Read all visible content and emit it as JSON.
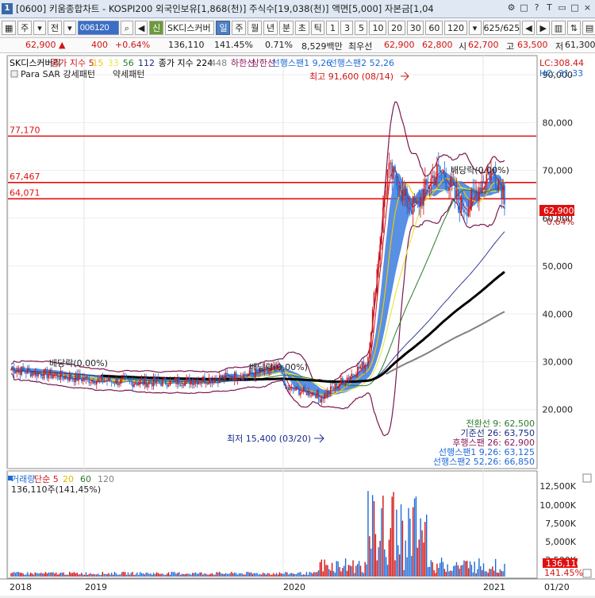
{
  "titlebar": {
    "icon_text": "1",
    "title": "[0600] 키움종합차트 - KOSPI200 외국인보유[1,868(천)] 주식수[19,038(천)] 액면[5,000] 자본금[1,04",
    "icons": [
      "gear-icon",
      "restore-icon",
      "help-icon",
      "pin-icon",
      "minimize-icon",
      "maximize-icon",
      "close-icon"
    ],
    "icon_glyphs": [
      "⚙",
      "□",
      "?",
      "T",
      "▭",
      "□",
      "×"
    ]
  },
  "toolbar": {
    "market": "주",
    "prev": "전",
    "code": "006120",
    "credit": "신",
    "stock_name": "SK디스커버",
    "periods": [
      "일",
      "주",
      "월",
      "년",
      "분",
      "초",
      "틱"
    ],
    "active_period": "일",
    "intervals": [
      "1",
      "3",
      "5",
      "10",
      "20",
      "30",
      "60",
      "120"
    ],
    "count": "625/625"
  },
  "quote": {
    "price": "62,900 ▲",
    "change": "400",
    "pct": "+0.64%",
    "volume": "136,110",
    "vol_ratio": "141.45%",
    "turnover": "0.71%",
    "amount": "8,529백만",
    "pref_label": "최우선",
    "ask": "62,900",
    "bid": "62,800",
    "open_label": "시",
    "open": "62,700",
    "high_label": "고",
    "high": "63,500",
    "low_label": "저",
    "low": "61,300"
  },
  "legend": {
    "line1": [
      {
        "text": "SK디스커버리",
        "color": "#000000"
      },
      {
        "text": "종가 지수 5",
        "color": "#d21414"
      },
      {
        "text": "15",
        "color": "#f0c800"
      },
      {
        "text": "33",
        "color": "#e6e64b"
      },
      {
        "text": "56",
        "color": "#2c7a2c"
      },
      {
        "text": "112",
        "color": "#1a2a8a"
      },
      {
        "text": "종가 지수 224",
        "color": "#000000"
      },
      {
        "text": "448",
        "color": "#808080"
      },
      {
        "text": "하한선",
        "color": "#8b1a5b"
      },
      {
        "text": "상한선",
        "color": "#8b1a5b"
      },
      {
        "text": "선행스팬1 9,26",
        "color": "#1e6bd6"
      },
      {
        "text": "선행스팬2 52,26",
        "color": "#1e6bd6"
      }
    ],
    "line2": [
      {
        "text": "Para SAR 강세패턴",
        "color": "#000000"
      },
      {
        "text": "약세패턴",
        "color": "#000000"
      }
    ],
    "lc": "LC:308.44",
    "hc": "HC:-31.33"
  },
  "price_axis": [
    "90,000",
    "80,000",
    "70,000",
    "60,000",
    "50,000",
    "40,000",
    "30,000",
    "20,000"
  ],
  "hlines": [
    {
      "label": "77,170",
      "value": 77170
    },
    {
      "label": "67,467",
      "value": 67467
    },
    {
      "label": "64,071",
      "value": 64071
    }
  ],
  "annotations": {
    "high": "최고 91,600 (08/14)",
    "low": "최저 15,400 (03/20)",
    "div1": "배당락(0.00%)",
    "div2": "배당락(0.00%)",
    "div3": "배당락(0.00%)"
  },
  "current": {
    "price": "62,900",
    "pct": "0.64%"
  },
  "ichimoku": [
    "전환선 9: 62,500",
    "기준선 26: 63,750",
    "후행스팬 26: 62,900",
    "선행스팬1 9,26: 63,125",
    "선행스팬2 52,26: 66,850"
  ],
  "volume_panel": {
    "legend": [
      {
        "text": "거래량",
        "color": "#1e6bd6"
      },
      {
        "text": "단순 5",
        "color": "#d21414"
      },
      {
        "text": "20",
        "color": "#e0b800"
      },
      {
        "text": "60",
        "color": "#2c7a2c"
      },
      {
        "text": "120",
        "color": "#808080"
      }
    ],
    "value": "136,110주(141,45%)",
    "axis": [
      "12,500K",
      "10,000K",
      "7,500K",
      "5,000K",
      "2,500K"
    ],
    "current": "136,110",
    "current_pct": "141.45%"
  },
  "date_axis": [
    "2018",
    "2019",
    "2020",
    "2021",
    "01/20"
  ],
  "colors": {
    "up": "#d21414",
    "down": "#1e6bd6",
    "cloud": "#3a7de0",
    "bollinger": "#7a1850",
    "ma224": "#000000",
    "ma448": "#808080",
    "hline": "#e01010"
  }
}
